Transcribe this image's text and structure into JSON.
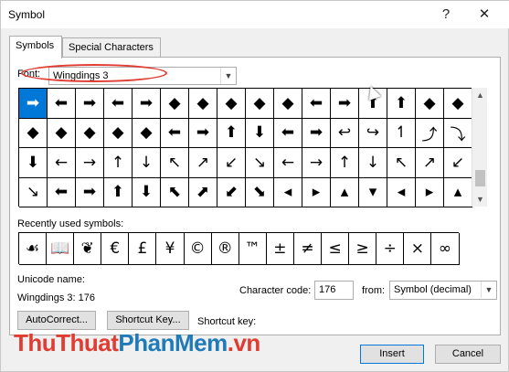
{
  "window": {
    "title": "Symbol",
    "help_glyph": "?",
    "close_glyph": "✕"
  },
  "tabs": [
    {
      "label": "Symbols",
      "active": true
    },
    {
      "label": "Special Characters",
      "active": false
    }
  ],
  "font": {
    "label": "Font:",
    "value": "Wingdings 3"
  },
  "symbol_grid": {
    "rows": [
      [
        "➡",
        "⬅",
        "➡",
        "⬅",
        "➡",
        "◆",
        "◆",
        "◆",
        "◆",
        "◆",
        "⬅",
        "➡",
        "⬆",
        "⬆",
        "◆",
        "◆"
      ],
      [
        "◆",
        "◆",
        "◆",
        "◆",
        "◆",
        "⬅",
        "➡",
        "⬆",
        "⬇",
        "⬅",
        "➡",
        "↩",
        "↪",
        "↿",
        "⤴",
        "⤵"
      ],
      [
        "⬇",
        "←",
        "→",
        "↑",
        "↓",
        "↖",
        "↗",
        "↙",
        "↘",
        "←",
        "→",
        "↑",
        "↓",
        "↖",
        "↗",
        "↙"
      ],
      [
        "↘",
        "⬅",
        "➡",
        "⬆",
        "⬇",
        "⬉",
        "⬈",
        "⬋",
        "⬊",
        "◂",
        "▸",
        "▴",
        "▾",
        "◂",
        "▸",
        "▴"
      ]
    ],
    "selected_index": 0
  },
  "recent": {
    "label": "Recently used symbols:",
    "items": [
      "☙",
      "📖",
      "❦",
      "€",
      "£",
      "¥",
      "©",
      "®",
      "™",
      "±",
      "≠",
      "≤",
      "≥",
      "÷",
      "×",
      "∞"
    ]
  },
  "unicode": {
    "label": "Unicode name:",
    "value": "Wingdings 3: 176"
  },
  "character_code": {
    "label": "Character code:",
    "value": "176"
  },
  "from": {
    "label": "from:",
    "value": "Symbol (decimal)"
  },
  "buttons": {
    "autocorrect": "AutoCorrect...",
    "shortcut_key": "Shortcut Key...",
    "insert": "Insert",
    "cancel": "Cancel"
  },
  "shortcut_key_label": "Shortcut key:",
  "watermark": {
    "part1": "ThuThuat",
    "part2": "PhanMem",
    "part3": ".vn"
  }
}
